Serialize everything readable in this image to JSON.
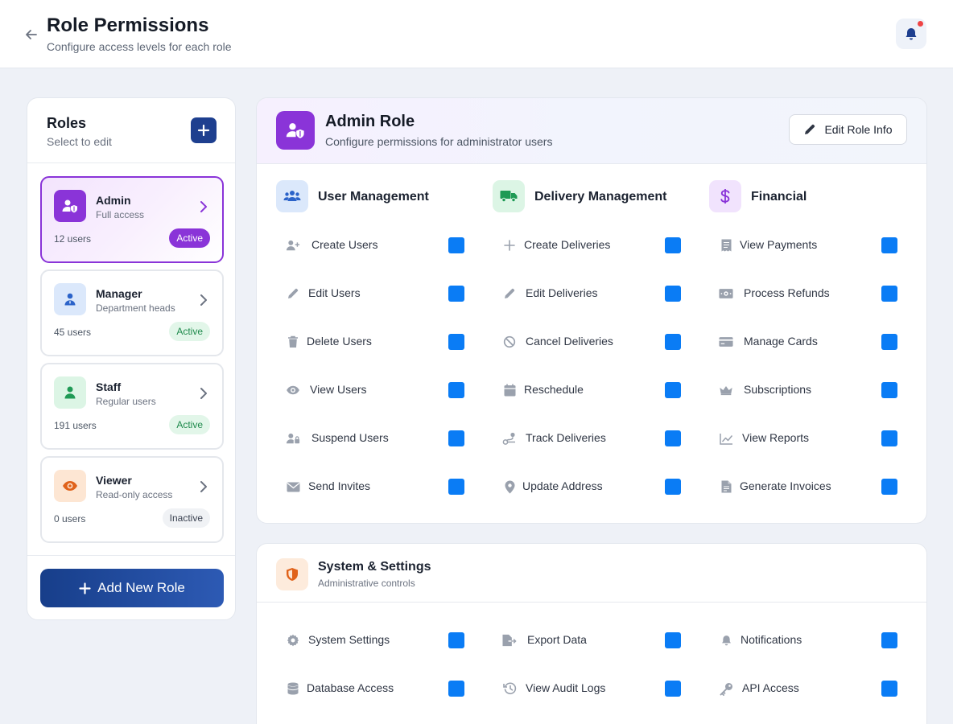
{
  "header": {
    "title": "Role Permissions",
    "subtitle": "Configure access levels for each role"
  },
  "roles_panel": {
    "title": "Roles",
    "subtitle": "Select to edit",
    "add_button_label": "Add New Role",
    "roles": [
      {
        "name": "Admin",
        "description": "Full access",
        "users": "12 users",
        "status": "Active",
        "selected": true
      },
      {
        "name": "Manager",
        "description": "Department heads",
        "users": "45 users",
        "status": "Active",
        "selected": false
      },
      {
        "name": "Staff",
        "description": "Regular users",
        "users": "191 users",
        "status": "Active",
        "selected": false
      },
      {
        "name": "Viewer",
        "description": "Read-only access",
        "users": "0 users",
        "status": "Inactive",
        "selected": false
      }
    ]
  },
  "admin_role": {
    "title": "Admin Role",
    "subtitle": "Configure permissions for administrator users",
    "edit_button": "Edit Role Info",
    "columns": [
      {
        "title": "User Management",
        "icon": "users-icon",
        "permissions": [
          {
            "label": "Create Users",
            "icon": "user-plus-icon",
            "checked": true
          },
          {
            "label": "Edit Users",
            "icon": "pencil-icon",
            "checked": true
          },
          {
            "label": "Delete Users",
            "icon": "trash-icon",
            "checked": true
          },
          {
            "label": "View Users",
            "icon": "eye-icon",
            "checked": true
          },
          {
            "label": "Suspend Users",
            "icon": "user-lock-icon",
            "checked": true
          },
          {
            "label": "Send Invites",
            "icon": "envelope-icon",
            "checked": true
          }
        ]
      },
      {
        "title": "Delivery Management",
        "icon": "truck-icon",
        "permissions": [
          {
            "label": "Create Deliveries",
            "icon": "plus-icon",
            "checked": true
          },
          {
            "label": "Edit Deliveries",
            "icon": "pencil-icon",
            "checked": true
          },
          {
            "label": "Cancel Deliveries",
            "icon": "ban-icon",
            "checked": true
          },
          {
            "label": "Reschedule",
            "icon": "calendar-icon",
            "checked": true
          },
          {
            "label": "Track Deliveries",
            "icon": "route-icon",
            "checked": true
          },
          {
            "label": "Update Address",
            "icon": "map-pin-icon",
            "checked": true
          }
        ]
      },
      {
        "title": "Financial",
        "icon": "dollar-icon",
        "permissions": [
          {
            "label": "View Payments",
            "icon": "receipt-icon",
            "checked": true
          },
          {
            "label": "Process Refunds",
            "icon": "money-icon",
            "checked": true
          },
          {
            "label": "Manage Cards",
            "icon": "credit-card-icon",
            "checked": true
          },
          {
            "label": "Subscriptions",
            "icon": "crown-icon",
            "checked": true
          },
          {
            "label": "View Reports",
            "icon": "chart-line-icon",
            "checked": true
          },
          {
            "label": "Generate Invoices",
            "icon": "file-invoice-icon",
            "checked": true
          }
        ]
      }
    ]
  },
  "system_settings": {
    "title": "System & Settings",
    "subtitle": "Administrative controls",
    "permissions": [
      {
        "label": "System Settings",
        "icon": "gear-icon",
        "checked": true
      },
      {
        "label": "Export Data",
        "icon": "file-export-icon",
        "checked": true
      },
      {
        "label": "Notifications",
        "icon": "bell-icon",
        "checked": true
      },
      {
        "label": "Database Access",
        "icon": "database-icon",
        "checked": true
      },
      {
        "label": "View Audit Logs",
        "icon": "history-icon",
        "checked": true
      },
      {
        "label": "API Access",
        "icon": "key-icon",
        "checked": true
      }
    ]
  },
  "colors": {
    "accent_purple": "#8a34d8",
    "primary_blue": "#1e3f8f",
    "checkbox_blue": "#0a7cf5",
    "active_green": "#1f8a4c"
  }
}
